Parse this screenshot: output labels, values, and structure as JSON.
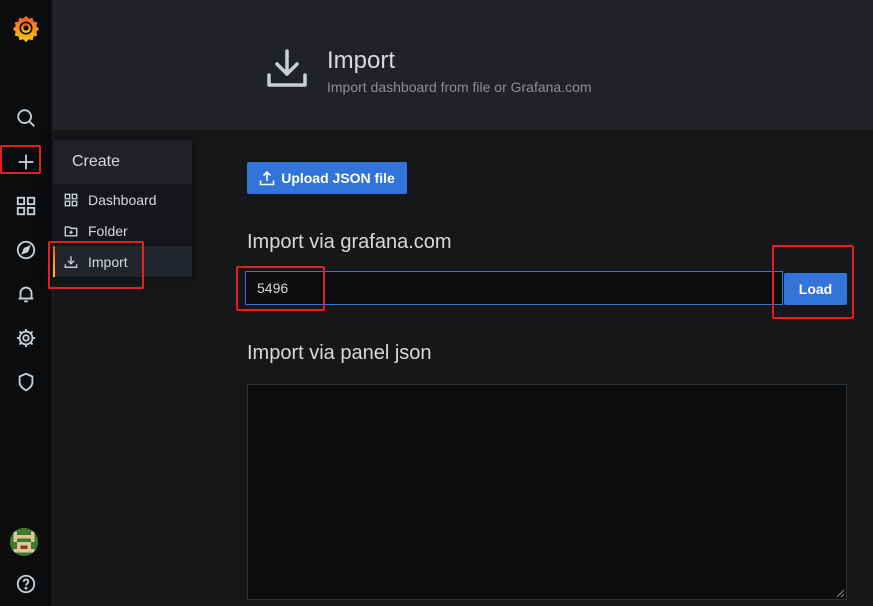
{
  "colors": {
    "accent": "#3274d9",
    "highlight": "#e3221f",
    "background": "#161719",
    "sidebar": "#0b0c0e"
  },
  "sidebar": {
    "icons": [
      "grafana-logo-icon",
      "search-icon",
      "plus-icon",
      "dashboards-icon",
      "explore-icon",
      "alerting-icon",
      "configuration-icon",
      "shield-icon",
      "user-avatar",
      "help-icon"
    ]
  },
  "create_menu": {
    "title": "Create",
    "items": [
      {
        "label": "Dashboard",
        "icon": "dashboard-grid-icon"
      },
      {
        "label": "Folder",
        "icon": "folder-plus-icon"
      },
      {
        "label": "Import",
        "icon": "import-download-icon",
        "active": true
      }
    ]
  },
  "header": {
    "title": "Import",
    "subtitle": "Import dashboard from file or Grafana.com"
  },
  "upload": {
    "label": "Upload JSON file"
  },
  "grafana_com": {
    "title": "Import via grafana.com",
    "input_value": "5496",
    "load_label": "Load"
  },
  "panel_json": {
    "title": "Import via panel json",
    "value": ""
  }
}
